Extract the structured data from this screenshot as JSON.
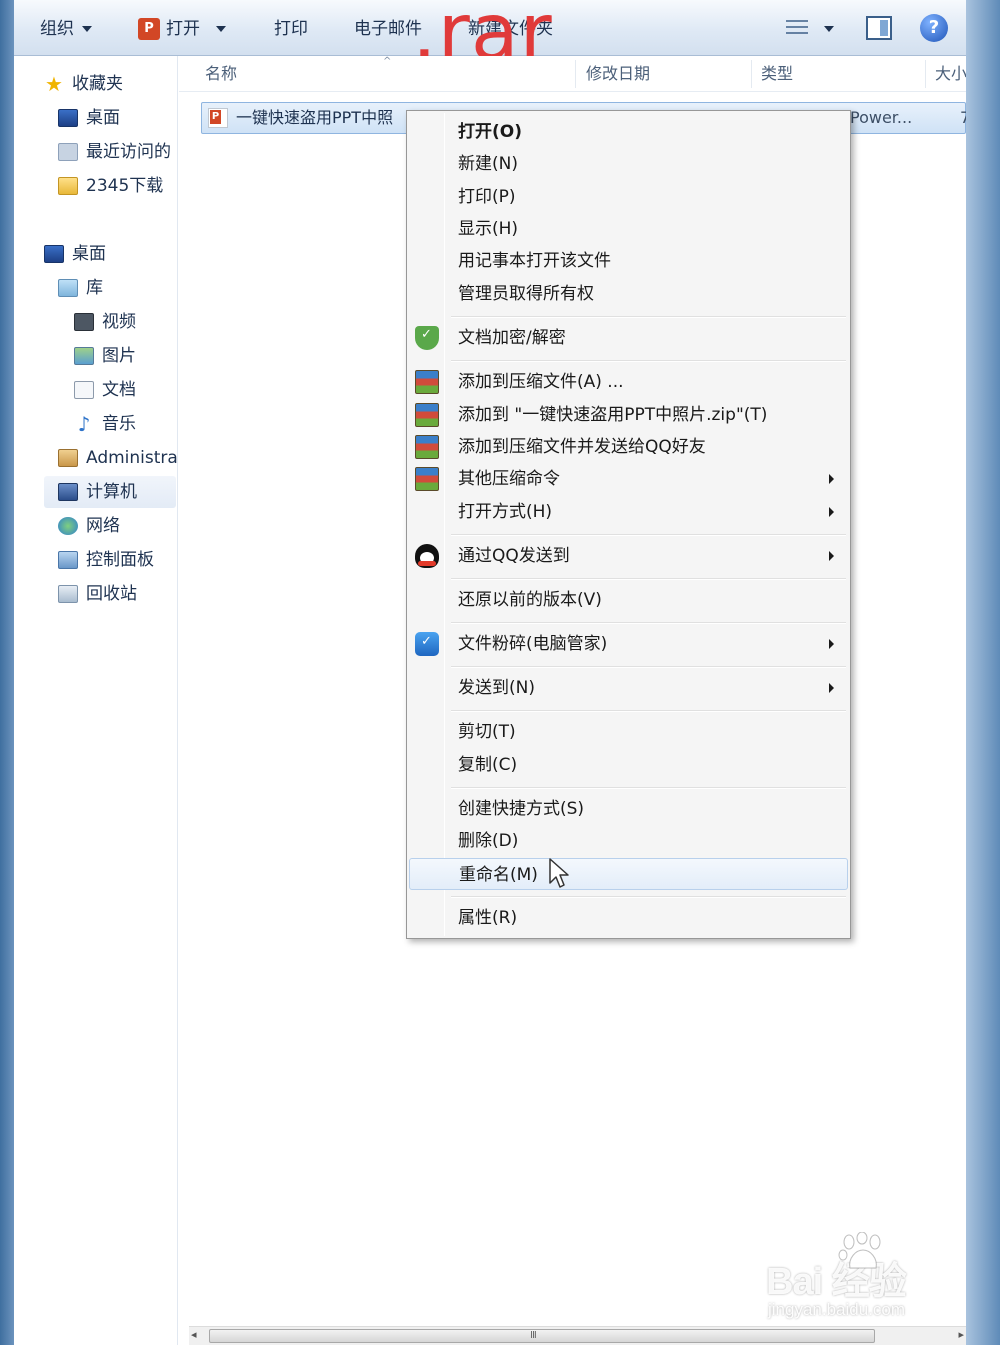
{
  "toolbar": {
    "organize": "组织",
    "open": "打开",
    "open_icon_letter": "P",
    "print": "打印",
    "email": "电子邮件",
    "new_folder": "新建文件夹",
    "help": "?"
  },
  "overlay_text": ".rar",
  "nav": {
    "favorites": "收藏夹",
    "fav_desktop": "桌面",
    "recent": "最近访问的",
    "downloads": "2345下载",
    "desktop": "桌面",
    "library": "库",
    "video": "视频",
    "pictures": "图片",
    "documents": "文档",
    "music": "音乐",
    "admin": "Administra",
    "computer": "计算机",
    "network": "网络",
    "control_panel": "控制面板",
    "recycle_bin": "回收站"
  },
  "columns": {
    "name": "名称",
    "modified": "修改日期",
    "type": "类型",
    "size": "大小"
  },
  "file": {
    "name": "一键快速盗用PPT中照",
    "type": "Power...",
    "size": "7"
  },
  "menu": {
    "items": [
      {
        "label": "打开(O)"
      },
      {
        "label": "新建(N)"
      },
      {
        "label": "打印(P)"
      },
      {
        "label": "显示(H)"
      },
      {
        "label": "用记事本打开该文件"
      },
      {
        "label": "管理员取得所有权"
      },
      {
        "label": "文档加密/解密"
      },
      {
        "label": "添加到压缩文件(A) ..."
      },
      {
        "label": "添加到 \"一键快速盗用PPT中照片.zip\"(T)"
      },
      {
        "label": "添加到压缩文件并发送给QQ好友"
      },
      {
        "label": "其他压缩命令"
      },
      {
        "label": "打开方式(H)"
      },
      {
        "label": "通过QQ发送到"
      },
      {
        "label": "还原以前的版本(V)"
      },
      {
        "label": "文件粉碎(电脑管家)"
      },
      {
        "label": "发送到(N)"
      },
      {
        "label": "剪切(T)"
      },
      {
        "label": "复制(C)"
      },
      {
        "label": "创建快捷方式(S)"
      },
      {
        "label": "删除(D)"
      },
      {
        "label": "重命名(M)"
      },
      {
        "label": "属性(R)"
      }
    ]
  },
  "scrollbar": {
    "grip": "III",
    "left": "◂",
    "right": "▸"
  },
  "watermark": {
    "brand": "Bai  经验",
    "url": "jingyan.baidu.com"
  }
}
